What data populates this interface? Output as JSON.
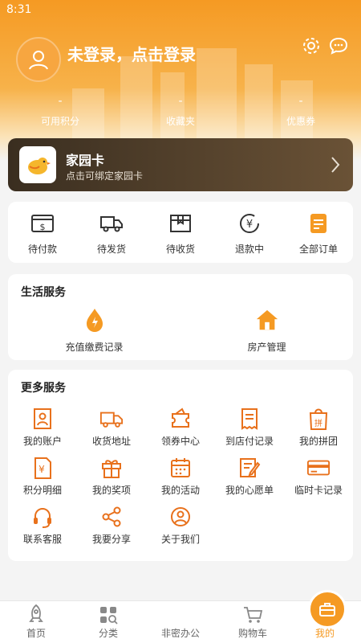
{
  "status_bar": {
    "time": "8:31"
  },
  "header": {
    "login_text": "未登录，点击登录",
    "stats": [
      {
        "value": "-",
        "label": "可用积分"
      },
      {
        "value": "-",
        "label": "收藏夹"
      },
      {
        "value": "-",
        "label": "优惠券"
      }
    ]
  },
  "home_card": {
    "title": "家园卡",
    "subtitle": "点击可绑定家园卡"
  },
  "orders": [
    {
      "label": "待付款",
      "icon": "wallet-icon"
    },
    {
      "label": "待发货",
      "icon": "truck-icon"
    },
    {
      "label": "待收货",
      "icon": "box-icon"
    },
    {
      "label": "退款中",
      "icon": "refund-icon"
    },
    {
      "label": "全部订单",
      "icon": "order-list-icon"
    }
  ],
  "life_services": {
    "title": "生活服务",
    "items": [
      {
        "label": "充值缴费记录",
        "icon": "flame-icon"
      },
      {
        "label": "房产管理",
        "icon": "house-icon"
      }
    ]
  },
  "more_services": {
    "title": "更多服务",
    "items": [
      {
        "label": "我的账户",
        "icon": "account-icon"
      },
      {
        "label": "收货地址",
        "icon": "delivery-truck-icon"
      },
      {
        "label": "领券中心",
        "icon": "coupon-icon"
      },
      {
        "label": "到店付记录",
        "icon": "receipt-icon"
      },
      {
        "label": "我的拼团",
        "icon": "group-buy-icon"
      },
      {
        "label": "积分明细",
        "icon": "points-icon"
      },
      {
        "label": "我的奖项",
        "icon": "gift-icon"
      },
      {
        "label": "我的活动",
        "icon": "calendar-icon"
      },
      {
        "label": "我的心愿单",
        "icon": "wishlist-icon"
      },
      {
        "label": "临时卡记录",
        "icon": "card-icon"
      },
      {
        "label": "联系客服",
        "icon": "headset-icon"
      },
      {
        "label": "我要分享",
        "icon": "share-icon"
      },
      {
        "label": "关于我们",
        "icon": "about-icon"
      }
    ]
  },
  "tabbar": [
    {
      "label": "首页",
      "icon": "rocket-icon"
    },
    {
      "label": "分类",
      "icon": "category-icon"
    },
    {
      "label": "非密办公",
      "icon": "briefcase-icon"
    },
    {
      "label": "购物车",
      "icon": "cart-icon"
    },
    {
      "label": "我的",
      "icon": "profile-icon",
      "active": true
    }
  ],
  "colors": {
    "accent": "#f59a23",
    "card_bg": "#3a2e20"
  }
}
